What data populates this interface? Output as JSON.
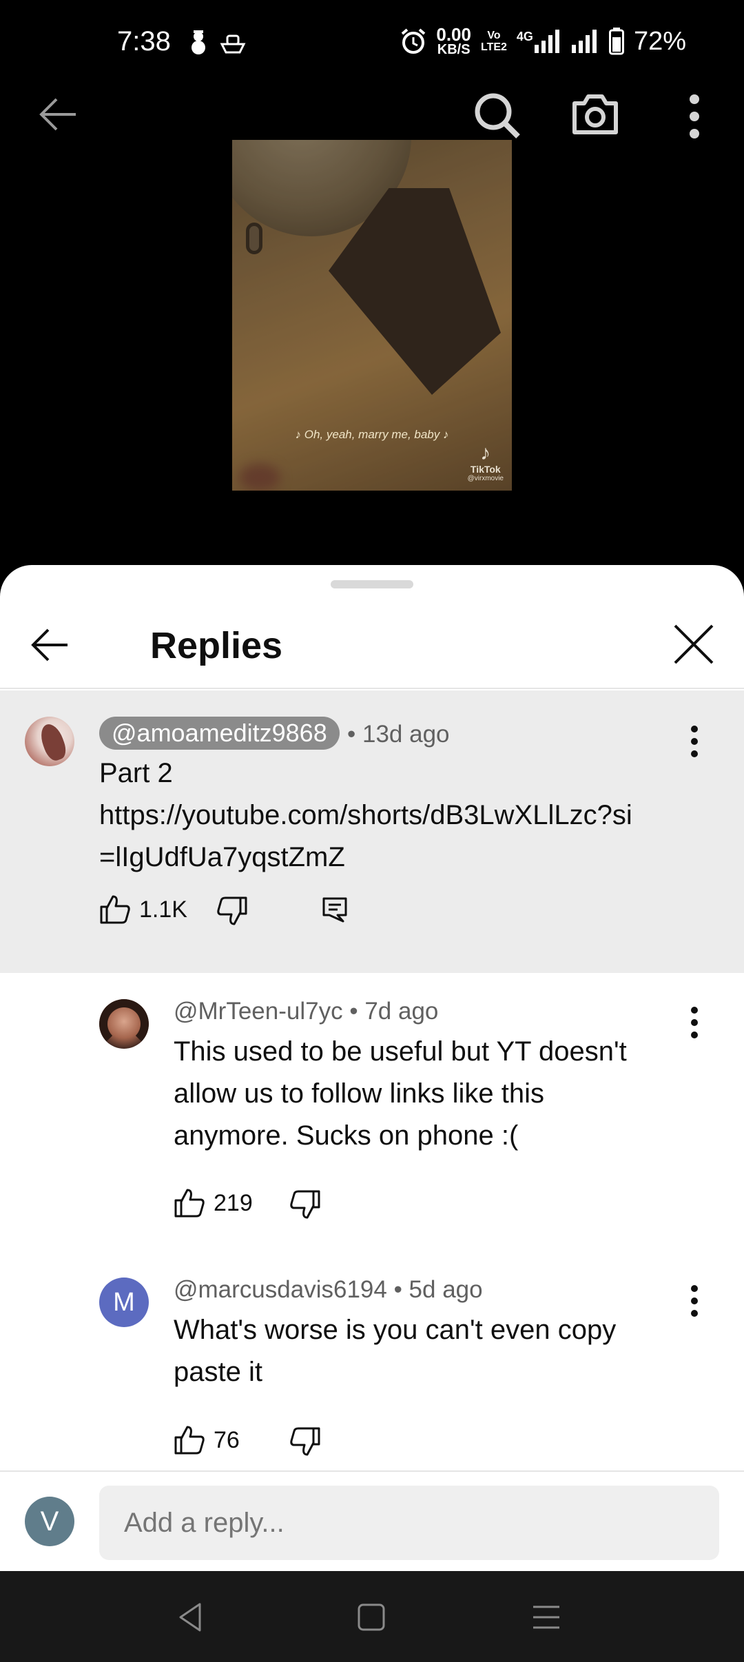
{
  "status_bar": {
    "time": "7:38",
    "net_speed_value": "0.00",
    "net_speed_unit": "KB/S",
    "volte_top": "Vo",
    "volte_bottom": "LTE2",
    "network": "4G",
    "battery": "72%",
    "icons": [
      "snowman-icon",
      "boat-icon",
      "alarm-icon",
      "signal-icon",
      "signal-icon",
      "battery-icon"
    ]
  },
  "top_nav": {
    "icons": [
      "back-arrow-icon",
      "search-icon",
      "camera-icon",
      "more-vert-icon"
    ]
  },
  "video": {
    "lyric": "♪ Oh, yeah, marry me, baby ♪",
    "watermark": "TikTok",
    "watermark_user": "@virxmovie"
  },
  "sheet": {
    "title": "Replies"
  },
  "parent_comment": {
    "handle": "@amoameditz9868",
    "age": "• 13d ago",
    "lines": [
      "Part 2",
      "https://youtube.com/shorts/dB3LwXLlLzc?si",
      "=lIgUdfUa7yqstZmZ"
    ],
    "likes": "1.1K"
  },
  "replies": [
    {
      "handle": "@MrTeen-ul7yc",
      "age": "• 7d ago",
      "lines": [
        "This used to be useful but YT doesn't",
        "allow us to follow links like this",
        "anymore. Sucks on phone :("
      ],
      "likes": "219"
    },
    {
      "handle": "@marcusdavis6194",
      "age": "• 5d ago",
      "avatar_letter": "M",
      "lines": [
        "What's worse is you can't even copy",
        "paste it"
      ],
      "likes": "76"
    }
  ],
  "composer": {
    "avatar_letter": "V",
    "placeholder": "Add a reply..."
  },
  "colors": {
    "sheet_bg": "#ffffff",
    "highlight_bg": "#ececec",
    "handle_pill": "#8b8b8b",
    "avatar_m": "#5c6bc0",
    "avatar_v": "#607d8b"
  }
}
